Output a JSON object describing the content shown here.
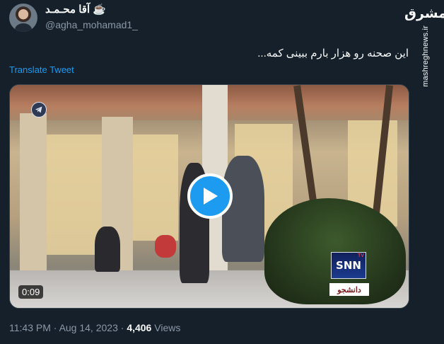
{
  "author": {
    "display_name": "☕ آقا محـمـد",
    "handle": "@agha_mohamad1_"
  },
  "watermark": {
    "logo_text": "مشرق",
    "url": "mashreghnews.ir"
  },
  "tweet": {
    "text": "این صحنه رو هزار بارم ببینی کمه...",
    "translate_label": "Translate Tweet"
  },
  "video": {
    "duration": "0:09",
    "channel_logo": "SNN",
    "channel_tv": "TV",
    "channel_subtitle": "دانشجو"
  },
  "meta": {
    "time": "11:43 PM",
    "separator1": " · ",
    "date": "Aug 14, 2023",
    "separator2": " · ",
    "views_count": "4,406",
    "views_label": " Views"
  },
  "colors": {
    "background": "#15202b",
    "accent": "#1d9bf0",
    "muted": "#8b98a5"
  }
}
